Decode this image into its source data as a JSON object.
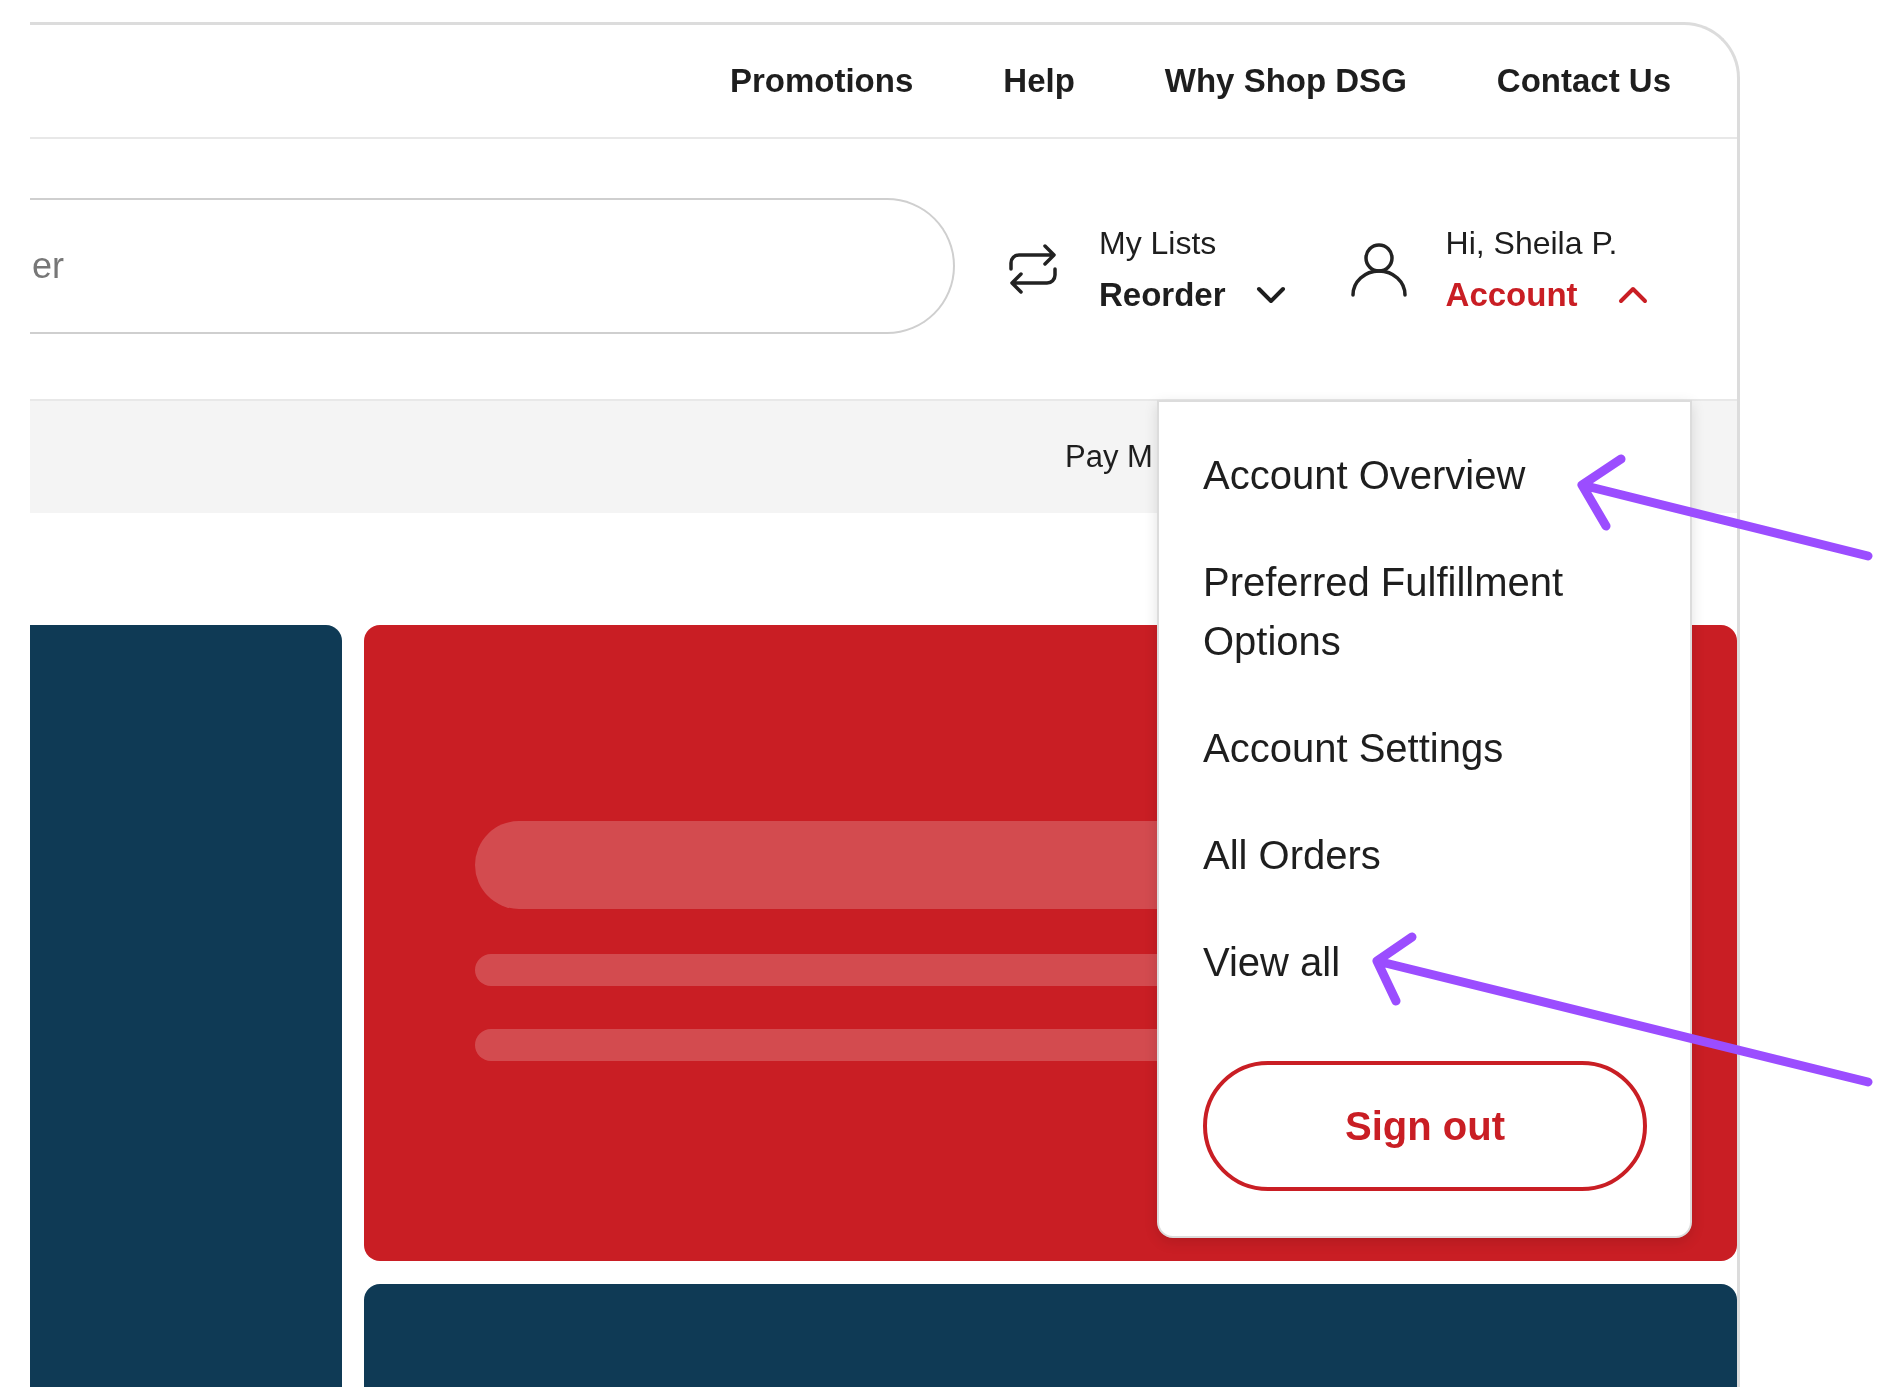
{
  "top_nav": [
    "Promotions",
    "Help",
    "Why Shop DSG",
    "Contact Us"
  ],
  "search": {
    "placeholder": "er"
  },
  "lists": {
    "greeting": "My Lists",
    "label": "Reorder",
    "expanded": false
  },
  "account": {
    "greeting": "Hi, Sheila P.",
    "label": "Account",
    "expanded": true
  },
  "banner": {
    "text": "Pay M"
  },
  "account_menu": {
    "items": [
      "Account Overview",
      "Preferred Fulfillment Options",
      "Account Settings",
      "All Orders",
      "View all"
    ],
    "button": "Sign out"
  }
}
